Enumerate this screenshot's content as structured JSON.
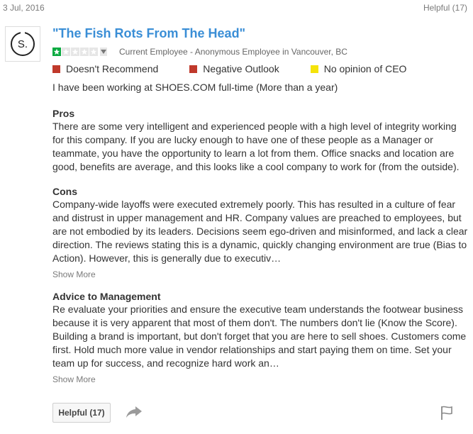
{
  "review": {
    "date": "3 Jul, 2016",
    "helpful_top": "Helpful (17)",
    "company_logo_text": "S.",
    "title": "\"The Fish Rots From The Head\"",
    "rating": 1,
    "rating_max": 5,
    "employee_info": "Current Employee - Anonymous Employee in Vancouver, BC",
    "opinions": [
      {
        "label": "Doesn't Recommend",
        "color": "#c0392b"
      },
      {
        "label": "Negative Outlook",
        "color": "#c0392b"
      },
      {
        "label": "No opinion of CEO",
        "color": "#f5e30a"
      }
    ],
    "main_text": "I have been working at SHOES.COM full-time (More than a year)",
    "pros_title": "Pros",
    "pros_text": "There are some very intelligent and experienced people with a high level of integrity working for this company. If you are lucky enough to have one of these people as a Manager or teammate, you have the opportunity to learn a lot from them. Office snacks and location are good, benefits are average, and this looks like a cool company to work for (from the outside).",
    "cons_title": "Cons",
    "cons_text": "Company-wide layoffs were executed extremely poorly. This has resulted in a culture of fear and distrust in upper management and HR. Company values are preached to employees, but are not embodied by its leaders. Decisions seem ego-driven and misinformed, and lack a clear direction. The reviews stating this is a dynamic, quickly changing environment are true (Bias to Action). However, this is generally due to executiv…",
    "show_more_1": "Show More",
    "advice_title": "Advice to Management",
    "advice_text": "Re evaluate your priorities and ensure the executive team understands the footwear business because it is very apparent that most of them don't. The numbers don't lie (Know the Score). Building a brand is important, but don't forget that you are here to sell shoes. Customers come first. Hold much more value in vendor relationships and start paying them on time. Set your team up for success, and recognize hard work an…",
    "show_more_2": "Show More",
    "helpful_button": "Helpful (17)"
  },
  "icons": {
    "share": "share-arrow-icon",
    "flag": "flag-icon",
    "star": "star-icon"
  },
  "colors": {
    "title": "#3a8ed6",
    "star_filled": "#0caa41",
    "star_empty": "#e6e6e6"
  }
}
